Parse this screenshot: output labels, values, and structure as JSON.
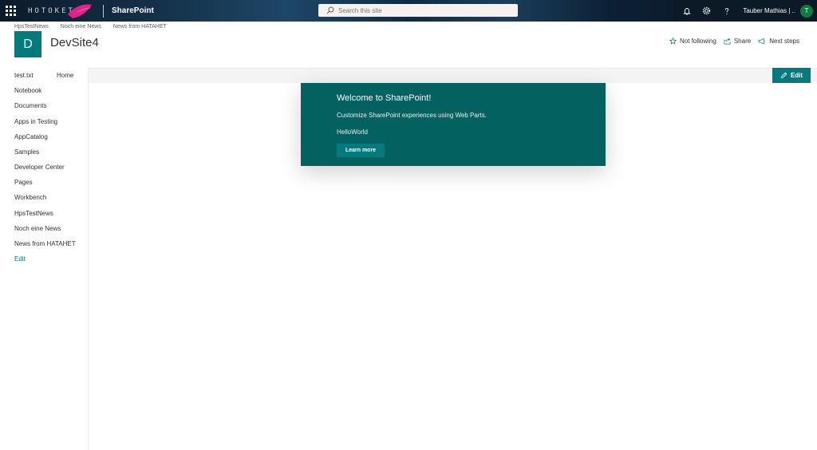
{
  "suitebar": {
    "logo_text": "HOTOKET",
    "app_name": "SharePoint",
    "search_placeholder": "Search this site",
    "user_name": "Tauber Mathias | ..",
    "user_initial": "T",
    "avatar_color": "#0f7b3f"
  },
  "hub_nav": {
    "links": [
      "HpsTestNews",
      "Noch eine News",
      "News from HATAHET"
    ]
  },
  "site": {
    "logo_letter": "D",
    "title": "DevSite4",
    "theme_color": "#037a7e",
    "actions": {
      "follow": "Not following",
      "share": "Share",
      "next_steps": "Next steps"
    }
  },
  "commandbar": {
    "home": "Home",
    "edit": "Edit"
  },
  "leftnav": {
    "items": [
      "test.txt",
      "Notebook",
      "Documents",
      "Apps in Testing",
      "AppCatalog",
      "Samples",
      "Developer Center",
      "Pages",
      "Workbench",
      "HpsTestNews",
      "Noch eine News",
      "News from HATAHET"
    ],
    "edit": "Edit"
  },
  "webpart": {
    "title": "Welcome to SharePoint!",
    "description": "Customize SharePoint experiences using Web Parts.",
    "property": "HelloWorld",
    "button": "Learn more",
    "background": "#03625f"
  }
}
